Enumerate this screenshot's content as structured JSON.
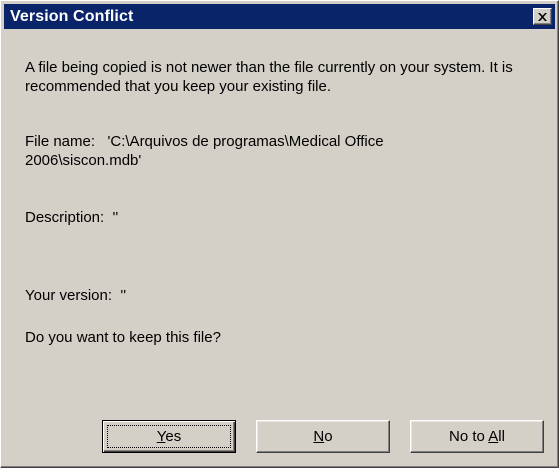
{
  "window": {
    "title": "Version Conflict"
  },
  "message": {
    "intro": "A file being copied is not newer than the file currently on your system. It is recommended that you keep your existing file.",
    "file_name": "File name:   'C:\\Arquivos de programas\\Medical Office 2006\\siscon.mdb'",
    "description": "Description:  ''",
    "your_version": "Your version:  ''",
    "question": "Do you want to keep this file?"
  },
  "buttons": {
    "yes": {
      "prefix": "",
      "mnemonic": "Y",
      "suffix": "es"
    },
    "no": {
      "prefix": "",
      "mnemonic": "N",
      "suffix": "o"
    },
    "no_to_all": {
      "prefix": "No to ",
      "mnemonic": "A",
      "suffix": "ll"
    }
  },
  "icons": {
    "close": "close-icon"
  },
  "colors": {
    "titlebar": "#0a246a",
    "face": "#d4d0c8"
  }
}
